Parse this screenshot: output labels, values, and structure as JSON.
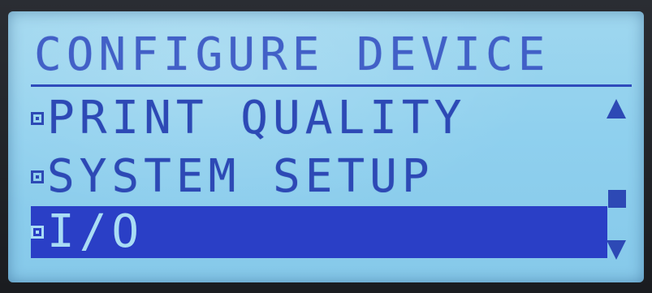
{
  "screen": {
    "title": "CONFIGURE DEVICE",
    "menu": [
      {
        "label": "PRINT QUALITY",
        "selected": false
      },
      {
        "label": "SYSTEM SETUP",
        "selected": false
      },
      {
        "label": "I/O",
        "selected": true
      }
    ]
  },
  "scrollbar": {
    "up_icon": "triangle-up",
    "down_icon": "triangle-down",
    "thumb_icon": "square"
  },
  "colors": {
    "lcd_background": "#8fd0ee",
    "lcd_text": "#2d49b5",
    "selection_background": "#2a3fc6",
    "selection_text": "#a9dcf5"
  }
}
